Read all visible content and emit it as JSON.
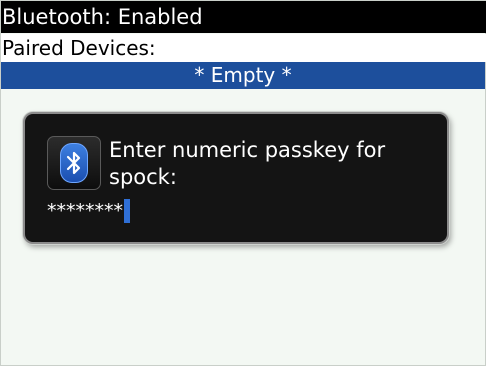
{
  "titlebar": {
    "status_text": "Bluetooth: Enabled"
  },
  "paired_devices": {
    "label": "Paired Devices:",
    "empty_row_text": "* Empty *"
  },
  "passkey_dialog": {
    "icon": "bluetooth-icon",
    "prompt": "Enter numeric passkey for spock:",
    "passkey_value": "********"
  },
  "colors": {
    "titlebar_bg": "#000000",
    "selection_bg": "#1d4f9c",
    "dialog_bg": "#141414",
    "bluetooth_blue": "#2f6fd6",
    "page_bg": "#f3f8f3"
  }
}
